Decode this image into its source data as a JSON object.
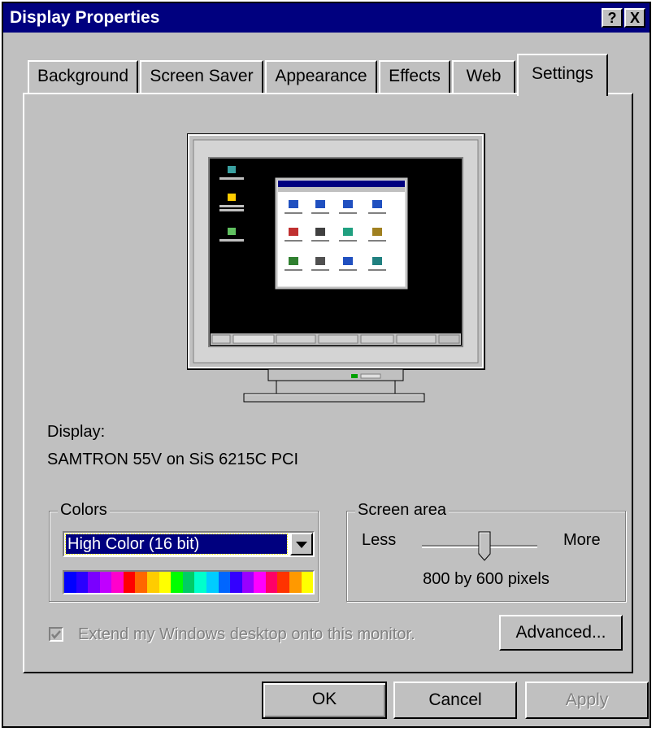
{
  "window": {
    "title": "Display Properties",
    "help_label": "?",
    "close_label": "X"
  },
  "tabs": [
    {
      "label": "Background"
    },
    {
      "label": "Screen Saver"
    },
    {
      "label": "Appearance"
    },
    {
      "label": "Effects"
    },
    {
      "label": "Web"
    },
    {
      "label": "Settings",
      "active": true
    }
  ],
  "display": {
    "label": "Display:",
    "name": "SAMTRON 55V on SiS 6215C PCI"
  },
  "colors": {
    "group_label": "Colors",
    "selected": "High Color (16 bit)",
    "spectrum": [
      "#0000ff",
      "#2a00ff",
      "#7a00ff",
      "#c000ff",
      "#ff00cc",
      "#ff0000",
      "#ff6600",
      "#ffcc00",
      "#ffff00",
      "#00ff00",
      "#00cc66",
      "#00ffcc",
      "#00ccff",
      "#0066ff",
      "#3300ff",
      "#9900ff",
      "#ff00ff",
      "#ff0066",
      "#ff3300",
      "#ff9900",
      "#ffff00"
    ]
  },
  "screen_area": {
    "group_label": "Screen area",
    "less_label": "Less",
    "more_label": "More",
    "resolution": "800 by 600 pixels",
    "slider_position": 0.55
  },
  "extend_checkbox": {
    "label": "Extend my Windows desktop onto this monitor.",
    "checked": true,
    "enabled": false
  },
  "buttons": {
    "advanced": "Advanced...",
    "ok": "OK",
    "cancel": "Cancel",
    "apply": "Apply"
  }
}
